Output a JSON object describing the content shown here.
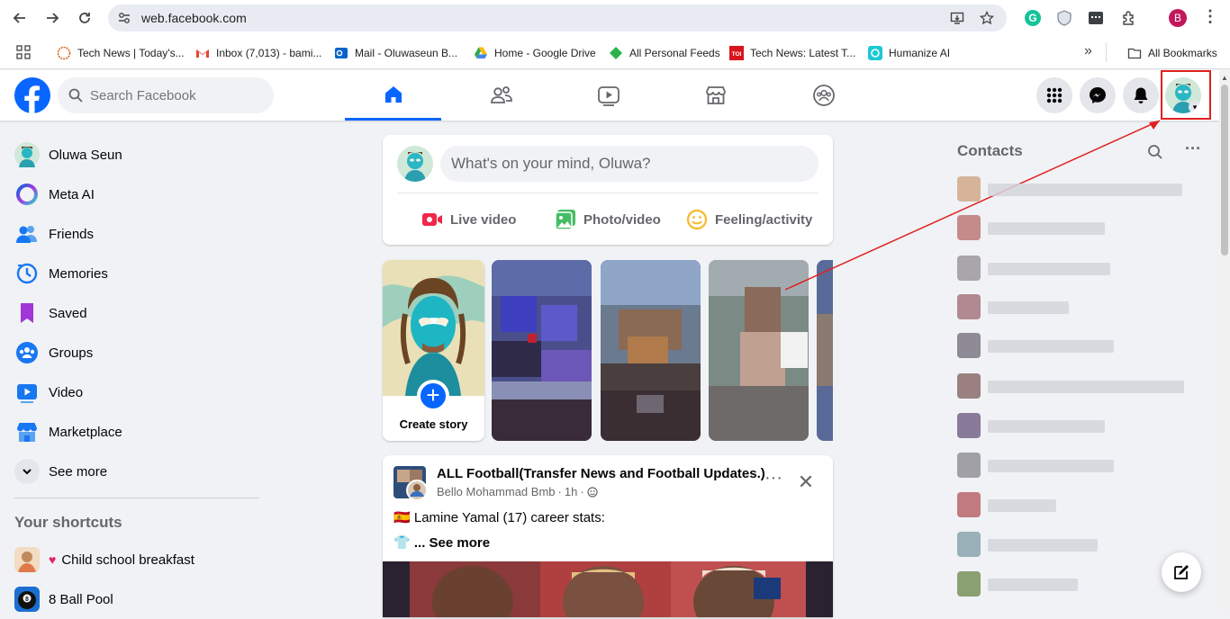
{
  "browser": {
    "url": "web.facebook.com",
    "profile_initial": "B",
    "bookmarks": [
      {
        "label": "Tech News | Today's..."
      },
      {
        "label": "Inbox (7,013) - bami..."
      },
      {
        "label": "Mail - Oluwaseun B..."
      },
      {
        "label": "Home - Google Drive"
      },
      {
        "label": "All Personal Feeds"
      },
      {
        "label": "Tech News: Latest T..."
      },
      {
        "label": "Humanize AI"
      }
    ],
    "all_bookmarks": "All Bookmarks",
    "more_chevron": "»"
  },
  "header": {
    "search_placeholder": "Search Facebook",
    "tabs": [
      "home-tab",
      "friends-tab",
      "video-tab",
      "marketplace-tab",
      "groups-tab"
    ],
    "active_tab": "home-tab"
  },
  "sidebar": {
    "items": [
      {
        "label": "Oluwa Seun",
        "icon": "avatar"
      },
      {
        "label": "Meta AI",
        "icon": "meta-ai-icon"
      },
      {
        "label": "Friends",
        "icon": "friends-icon"
      },
      {
        "label": "Memories",
        "icon": "memories-icon"
      },
      {
        "label": "Saved",
        "icon": "saved-icon"
      },
      {
        "label": "Groups",
        "icon": "groups-icon"
      },
      {
        "label": "Video",
        "icon": "video-icon"
      },
      {
        "label": "Marketplace",
        "icon": "marketplace-icon"
      },
      {
        "label": "See more",
        "icon": "chevron-down-icon"
      }
    ],
    "shortcuts_title": "Your shortcuts",
    "shortcuts": [
      {
        "label": "Child school breakfast",
        "prefix": "♥"
      },
      {
        "label": "8 Ball Pool"
      }
    ]
  },
  "composer": {
    "placeholder": "What's on your mind, Oluwa?",
    "actions": [
      "Live video",
      "Photo/video",
      "Feeling/activity"
    ]
  },
  "stories": {
    "create_label": "Create story",
    "plus": "+"
  },
  "post": {
    "page_name": "ALL Football(Transfer News and Football Updates.)",
    "author": "Bello Mohammad Bmb",
    "time": "1h",
    "line1": "Lamine Yamal (17) career stats:",
    "line2": "... See more",
    "line1_emoji": "🇪🇸",
    "line2_emoji": "👕",
    "more": "···",
    "close": "✕"
  },
  "contacts": {
    "title": "Contacts"
  },
  "colors": {
    "brand": "#0866ff",
    "highlight": "#e02020"
  }
}
